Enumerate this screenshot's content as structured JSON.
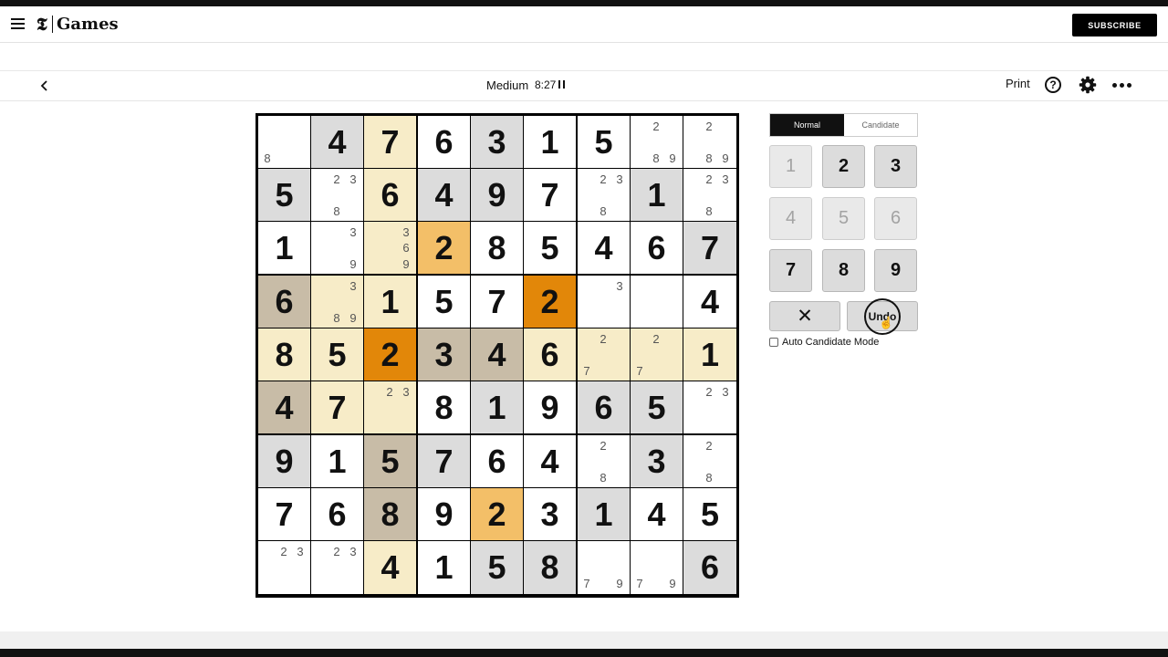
{
  "header": {
    "menu_icon": "hamburger-icon",
    "logo_mark": "𝕿",
    "brand": "Games",
    "subscribe": "SUBSCRIBE"
  },
  "toolbar": {
    "back_icon": "chevron-left-icon",
    "difficulty": "Medium",
    "timer": "8:27",
    "pause_icon": "pause-icon",
    "print": "Print",
    "help": "?",
    "help_icon": "help-circle-icon",
    "settings_icon": "gear-icon",
    "more_icon": "more-horizontal-icon"
  },
  "colors": {
    "grid": "#000000",
    "white": "#ffffff",
    "grey": "#dcdcdc",
    "cream": "#f7ecc8",
    "taupe": "#c8bca7",
    "light_orange": "#f3bf68",
    "dark_orange": "#e28709"
  },
  "board": {
    "cells": [
      [
        {
          "value": "",
          "bg": "white",
          "cands": [
            {
              "d": "8",
              "pos": "bottom-left"
            }
          ]
        },
        {
          "value": "4",
          "bg": "grey"
        },
        {
          "value": "7",
          "bg": "cream"
        },
        {
          "value": "6",
          "bg": "white"
        },
        {
          "value": "3",
          "bg": "grey"
        },
        {
          "value": "1",
          "bg": "white"
        },
        {
          "value": "5",
          "bg": "white"
        },
        {
          "value": "",
          "bg": "white",
          "cands": [
            {
              "d": "2",
              "pos": "top-center"
            },
            {
              "d": "8",
              "pos": "bottom-center"
            },
            {
              "d": "9",
              "pos": "bottom-right"
            }
          ]
        },
        {
          "value": "",
          "bg": "white",
          "cands": [
            {
              "d": "2",
              "pos": "top-center"
            },
            {
              "d": "8",
              "pos": "bottom-center"
            },
            {
              "d": "9",
              "pos": "bottom-right"
            }
          ]
        }
      ],
      [
        {
          "value": "5",
          "bg": "grey"
        },
        {
          "value": "",
          "bg": "white",
          "cands": [
            {
              "d": "2",
              "pos": "top-center"
            },
            {
              "d": "3",
              "pos": "top-right"
            },
            {
              "d": "8",
              "pos": "bottom-center"
            }
          ]
        },
        {
          "value": "6",
          "bg": "cream"
        },
        {
          "value": "4",
          "bg": "grey"
        },
        {
          "value": "9",
          "bg": "grey"
        },
        {
          "value": "7",
          "bg": "white"
        },
        {
          "value": "",
          "bg": "white",
          "cands": [
            {
              "d": "2",
              "pos": "top-center"
            },
            {
              "d": "3",
              "pos": "top-right"
            },
            {
              "d": "8",
              "pos": "bottom-center"
            }
          ]
        },
        {
          "value": "1",
          "bg": "grey"
        },
        {
          "value": "",
          "bg": "white",
          "cands": [
            {
              "d": "2",
              "pos": "top-center"
            },
            {
              "d": "3",
              "pos": "top-right"
            },
            {
              "d": "8",
              "pos": "bottom-center"
            }
          ]
        }
      ],
      [
        {
          "value": "1",
          "bg": "white"
        },
        {
          "value": "",
          "bg": "white",
          "cands": [
            {
              "d": "3",
              "pos": "top-right"
            },
            {
              "d": "9",
              "pos": "bottom-right"
            }
          ]
        },
        {
          "value": "",
          "bg": "cream",
          "cands": [
            {
              "d": "3",
              "pos": "top-right"
            },
            {
              "d": "6",
              "pos": "middle-right"
            },
            {
              "d": "9",
              "pos": "bottom-right"
            }
          ]
        },
        {
          "value": "2",
          "bg": "light_orange"
        },
        {
          "value": "8",
          "bg": "white"
        },
        {
          "value": "5",
          "bg": "white"
        },
        {
          "value": "4",
          "bg": "white"
        },
        {
          "value": "6",
          "bg": "white"
        },
        {
          "value": "7",
          "bg": "grey"
        }
      ],
      [
        {
          "value": "6",
          "bg": "taupe"
        },
        {
          "value": "",
          "bg": "cream",
          "cands": [
            {
              "d": "3",
              "pos": "top-right"
            },
            {
              "d": "8",
              "pos": "bottom-center"
            },
            {
              "d": "9",
              "pos": "bottom-right"
            }
          ]
        },
        {
          "value": "1",
          "bg": "cream"
        },
        {
          "value": "5",
          "bg": "white"
        },
        {
          "value": "7",
          "bg": "white"
        },
        {
          "value": "2",
          "bg": "dark_orange"
        },
        {
          "value": "",
          "bg": "white",
          "cands": [
            {
              "d": "3",
              "pos": "top-right"
            }
          ]
        },
        {
          "value": "",
          "bg": "white"
        },
        {
          "value": "4",
          "bg": "white"
        }
      ],
      [
        {
          "value": "8",
          "bg": "cream"
        },
        {
          "value": "5",
          "bg": "cream"
        },
        {
          "value": "2",
          "bg": "dark_orange"
        },
        {
          "value": "3",
          "bg": "taupe"
        },
        {
          "value": "4",
          "bg": "taupe"
        },
        {
          "value": "6",
          "bg": "cream"
        },
        {
          "value": "",
          "bg": "cream",
          "cands": [
            {
              "d": "2",
              "pos": "top-center"
            },
            {
              "d": "7",
              "pos": "bottom-left"
            }
          ]
        },
        {
          "value": "",
          "bg": "cream",
          "cands": [
            {
              "d": "2",
              "pos": "top-center"
            },
            {
              "d": "7",
              "pos": "bottom-left"
            }
          ]
        },
        {
          "value": "1",
          "bg": "cream"
        }
      ],
      [
        {
          "value": "4",
          "bg": "taupe"
        },
        {
          "value": "7",
          "bg": "cream"
        },
        {
          "value": "",
          "bg": "cream",
          "cands": [
            {
              "d": "2",
              "pos": "top-center"
            },
            {
              "d": "3",
              "pos": "top-right"
            }
          ]
        },
        {
          "value": "8",
          "bg": "white"
        },
        {
          "value": "1",
          "bg": "grey"
        },
        {
          "value": "9",
          "bg": "white"
        },
        {
          "value": "6",
          "bg": "grey"
        },
        {
          "value": "5",
          "bg": "grey"
        },
        {
          "value": "",
          "bg": "white",
          "cands": [
            {
              "d": "2",
              "pos": "top-center"
            },
            {
              "d": "3",
              "pos": "top-right"
            }
          ]
        }
      ],
      [
        {
          "value": "9",
          "bg": "grey"
        },
        {
          "value": "1",
          "bg": "white"
        },
        {
          "value": "5",
          "bg": "taupe"
        },
        {
          "value": "7",
          "bg": "grey"
        },
        {
          "value": "6",
          "bg": "white"
        },
        {
          "value": "4",
          "bg": "white"
        },
        {
          "value": "",
          "bg": "white",
          "cands": [
            {
              "d": "2",
              "pos": "top-center"
            },
            {
              "d": "8",
              "pos": "bottom-center"
            }
          ]
        },
        {
          "value": "3",
          "bg": "grey"
        },
        {
          "value": "",
          "bg": "white",
          "cands": [
            {
              "d": "2",
              "pos": "top-center"
            },
            {
              "d": "8",
              "pos": "bottom-center"
            }
          ]
        }
      ],
      [
        {
          "value": "7",
          "bg": "white"
        },
        {
          "value": "6",
          "bg": "white"
        },
        {
          "value": "8",
          "bg": "taupe"
        },
        {
          "value": "9",
          "bg": "white"
        },
        {
          "value": "2",
          "bg": "light_orange"
        },
        {
          "value": "3",
          "bg": "white"
        },
        {
          "value": "1",
          "bg": "grey"
        },
        {
          "value": "4",
          "bg": "white"
        },
        {
          "value": "5",
          "bg": "white"
        }
      ],
      [
        {
          "value": "",
          "bg": "white",
          "cands": [
            {
              "d": "2",
              "pos": "top-center"
            },
            {
              "d": "3",
              "pos": "top-right"
            }
          ]
        },
        {
          "value": "",
          "bg": "white",
          "cands": [
            {
              "d": "2",
              "pos": "top-center"
            },
            {
              "d": "3",
              "pos": "top-right"
            }
          ]
        },
        {
          "value": "4",
          "bg": "cream"
        },
        {
          "value": "1",
          "bg": "white"
        },
        {
          "value": "5",
          "bg": "grey"
        },
        {
          "value": "8",
          "bg": "grey"
        },
        {
          "value": "",
          "bg": "white",
          "cands": [
            {
              "d": "7",
              "pos": "bottom-left"
            },
            {
              "d": "9",
              "pos": "bottom-right"
            }
          ]
        },
        {
          "value": "",
          "bg": "white",
          "cands": [
            {
              "d": "7",
              "pos": "bottom-left"
            },
            {
              "d": "9",
              "pos": "bottom-right"
            }
          ]
        },
        {
          "value": "6",
          "bg": "grey"
        }
      ]
    ]
  },
  "controls": {
    "mode_normal": "Normal",
    "mode_candidate": "Candidate",
    "active_mode": "Normal",
    "keys": [
      {
        "label": "1",
        "disabled": true
      },
      {
        "label": "2",
        "disabled": false
      },
      {
        "label": "3",
        "disabled": false
      },
      {
        "label": "4",
        "disabled": true
      },
      {
        "label": "5",
        "disabled": true
      },
      {
        "label": "6",
        "disabled": true
      },
      {
        "label": "7",
        "disabled": false
      },
      {
        "label": "8",
        "disabled": false
      },
      {
        "label": "9",
        "disabled": false
      }
    ],
    "erase": "✕",
    "erase_icon": "close-icon",
    "undo": "Undo",
    "auto_candidate": "Auto Candidate Mode",
    "auto_candidate_checked": false
  }
}
